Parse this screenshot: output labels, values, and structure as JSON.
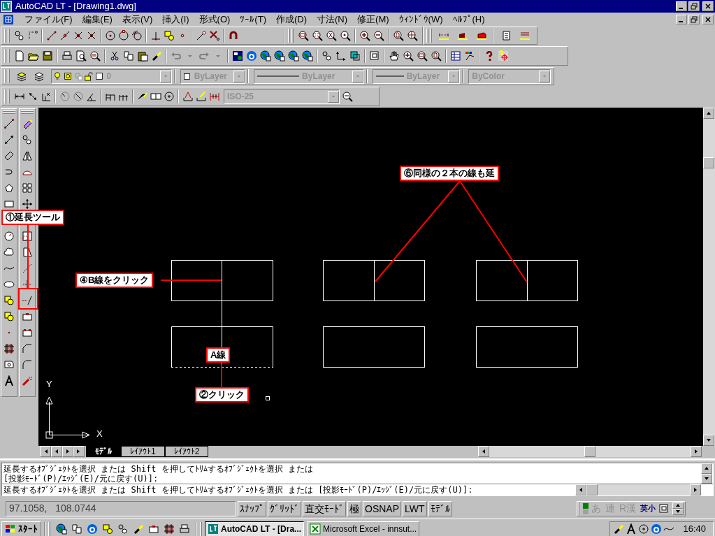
{
  "window": {
    "title": "AutoCAD LT - [Drawing1.dwg]"
  },
  "menu": [
    "ファイル(F)",
    "編集(E)",
    "表示(V)",
    "挿入(I)",
    "形式(O)",
    "ﾂｰﾙ(T)",
    "作成(D)",
    "寸法(N)",
    "修正(M)",
    "ｳｨﾝﾄﾞｳ(W)",
    "ﾍﾙﾌﾟ(H)"
  ],
  "combos": {
    "layer": {
      "value": "0",
      "disabled": true
    },
    "color": {
      "value": "ByLayer",
      "disabled": true
    },
    "linetype": {
      "value": "ByLayer",
      "disabled": true
    },
    "lineweight": {
      "value": "ByLayer",
      "disabled": true
    },
    "plot_style": {
      "value": "ByColor",
      "disabled": true
    },
    "dim_style": {
      "value": "ISO-25",
      "disabled": true
    }
  },
  "drawing": {
    "ucs": {
      "x_label": "X",
      "y_label": "Y"
    },
    "callouts": [
      {
        "text": "①延長ツール"
      },
      {
        "text": "④B線をクリック"
      },
      {
        "text": "A線"
      },
      {
        "text": "②クリック"
      },
      {
        "text": "⑥同様の２本の線も延"
      }
    ]
  },
  "layout_tabs": [
    {
      "label": "ﾓﾃﾞﾙ",
      "selected": true
    },
    {
      "label": "ﾚｲｱｳﾄ1",
      "selected": false
    },
    {
      "label": "ﾚｲｱｳﾄ2",
      "selected": false
    }
  ],
  "command_history": [
    "延長するｵﾌﾞｼﾞｪｸﾄを選択 または Shift を押してﾄﾘﾑするｵﾌﾞｼﾞｪｸﾄを選択 または",
    "[投影ﾓｰﾄﾞ(P)/ｴｯｼﾞ(E)/元に戻す(U)]:"
  ],
  "command_line": "延長するｵﾌﾞｼﾞｪｸﾄを選択 または Shift を押してﾄﾘﾑするｵﾌﾞｼﾞｪｸﾄを選択 または [投影ﾓｰﾄﾞ(P)/ｴｯｼﾞ(E)/元に戻す(U)]:",
  "status_bar": {
    "coordinates": "97.1058,   108.0744",
    "toggles": [
      "ｽﾅｯﾌﾟ",
      "ｸﾞﾘｯﾄﾞ",
      "直交ﾓｰﾄﾞ",
      "極",
      "OSNAP",
      "LWT",
      "ﾓﾃﾞﾙ"
    ]
  },
  "ime_bar": [
    "あ",
    "連",
    "R漢",
    "英小"
  ],
  "taskbar": {
    "start": "ｽﾀｰﾄ",
    "tasks": [
      {
        "label": "AutoCAD LT - [Dra...",
        "selected": true
      },
      {
        "label": "Microsoft Excel - innsut...",
        "selected": false
      }
    ],
    "clock": "16:40"
  }
}
